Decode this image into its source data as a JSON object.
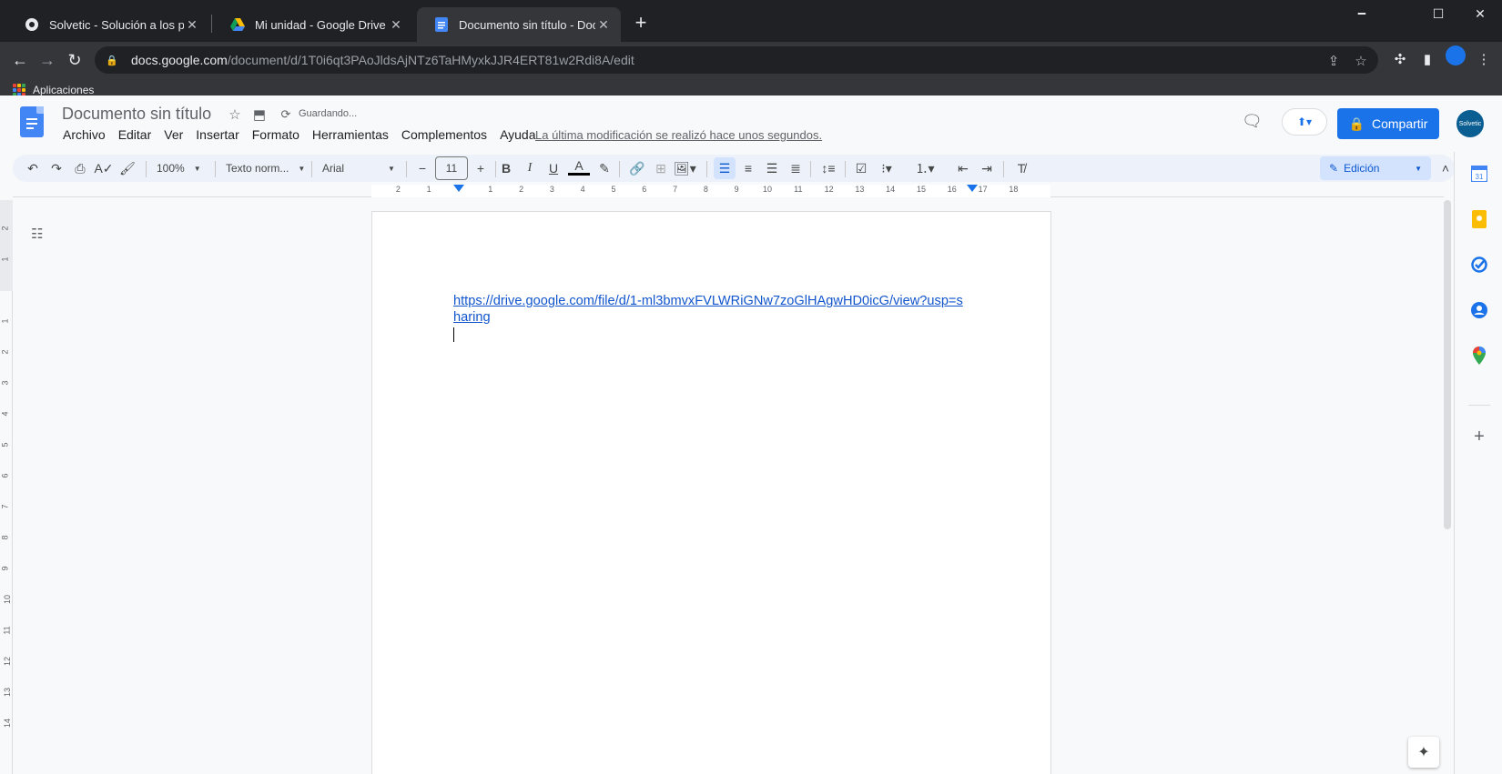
{
  "browser": {
    "tabs": [
      {
        "title": "Solvetic - Solución a los problem",
        "active": false,
        "favicon": "solvetic-favicon"
      },
      {
        "title": "Mi unidad - Google Drive",
        "active": false,
        "favicon": "google-drive-favicon"
      },
      {
        "title": "Documento sin título - Documen",
        "active": true,
        "favicon": "google-docs-favicon"
      }
    ],
    "url_host": "docs.google.com",
    "url_path": "/document/d/1T0i6qt3PAoJldsAjNTz6TaHMyxkJJR4ERT81w2Rdi8A/edit",
    "bookmarks": [
      {
        "label": "Aplicaciones",
        "icon": "apps-grid-icon"
      }
    ],
    "window_controls": {
      "minimize": "🗕",
      "maximize": "☐",
      "close": "✕"
    }
  },
  "docs": {
    "title": "Documento sin título",
    "save_status": "Guardando...",
    "menu": [
      "Archivo",
      "Editar",
      "Ver",
      "Insertar",
      "Formato",
      "Herramientas",
      "Complementos",
      "Ayuda"
    ],
    "last_modified": "La última modificación se realizó hace unos segundos.",
    "share_label": "Compartir",
    "avatar_label": "Solvetic",
    "accent_color": "#1a73e8"
  },
  "toolbar": {
    "zoom": "100%",
    "style": "Texto norm...",
    "font": "Arial",
    "font_size": "11",
    "mode": "Edición"
  },
  "ruler": {
    "numbers": [
      "2",
      "1",
      "1",
      "2",
      "3",
      "4",
      "5",
      "6",
      "7",
      "8",
      "9",
      "10",
      "11",
      "12",
      "13",
      "14",
      "15",
      "16",
      "17",
      "18"
    ],
    "vertical_numbers": [
      "2",
      "1",
      "1",
      "2",
      "3",
      "4",
      "5",
      "6",
      "7",
      "8",
      "9",
      "10",
      "11",
      "12",
      "13",
      "14"
    ]
  },
  "document": {
    "content_link": "https://drive.google.com/file/d/1-ml3bmvxFVLWRiGNw7zoGlHAgwHD0icG/view?usp=sharing"
  },
  "side_panel": [
    "calendar-icon",
    "keep-icon",
    "tasks-icon",
    "contacts-icon",
    "maps-icon"
  ]
}
